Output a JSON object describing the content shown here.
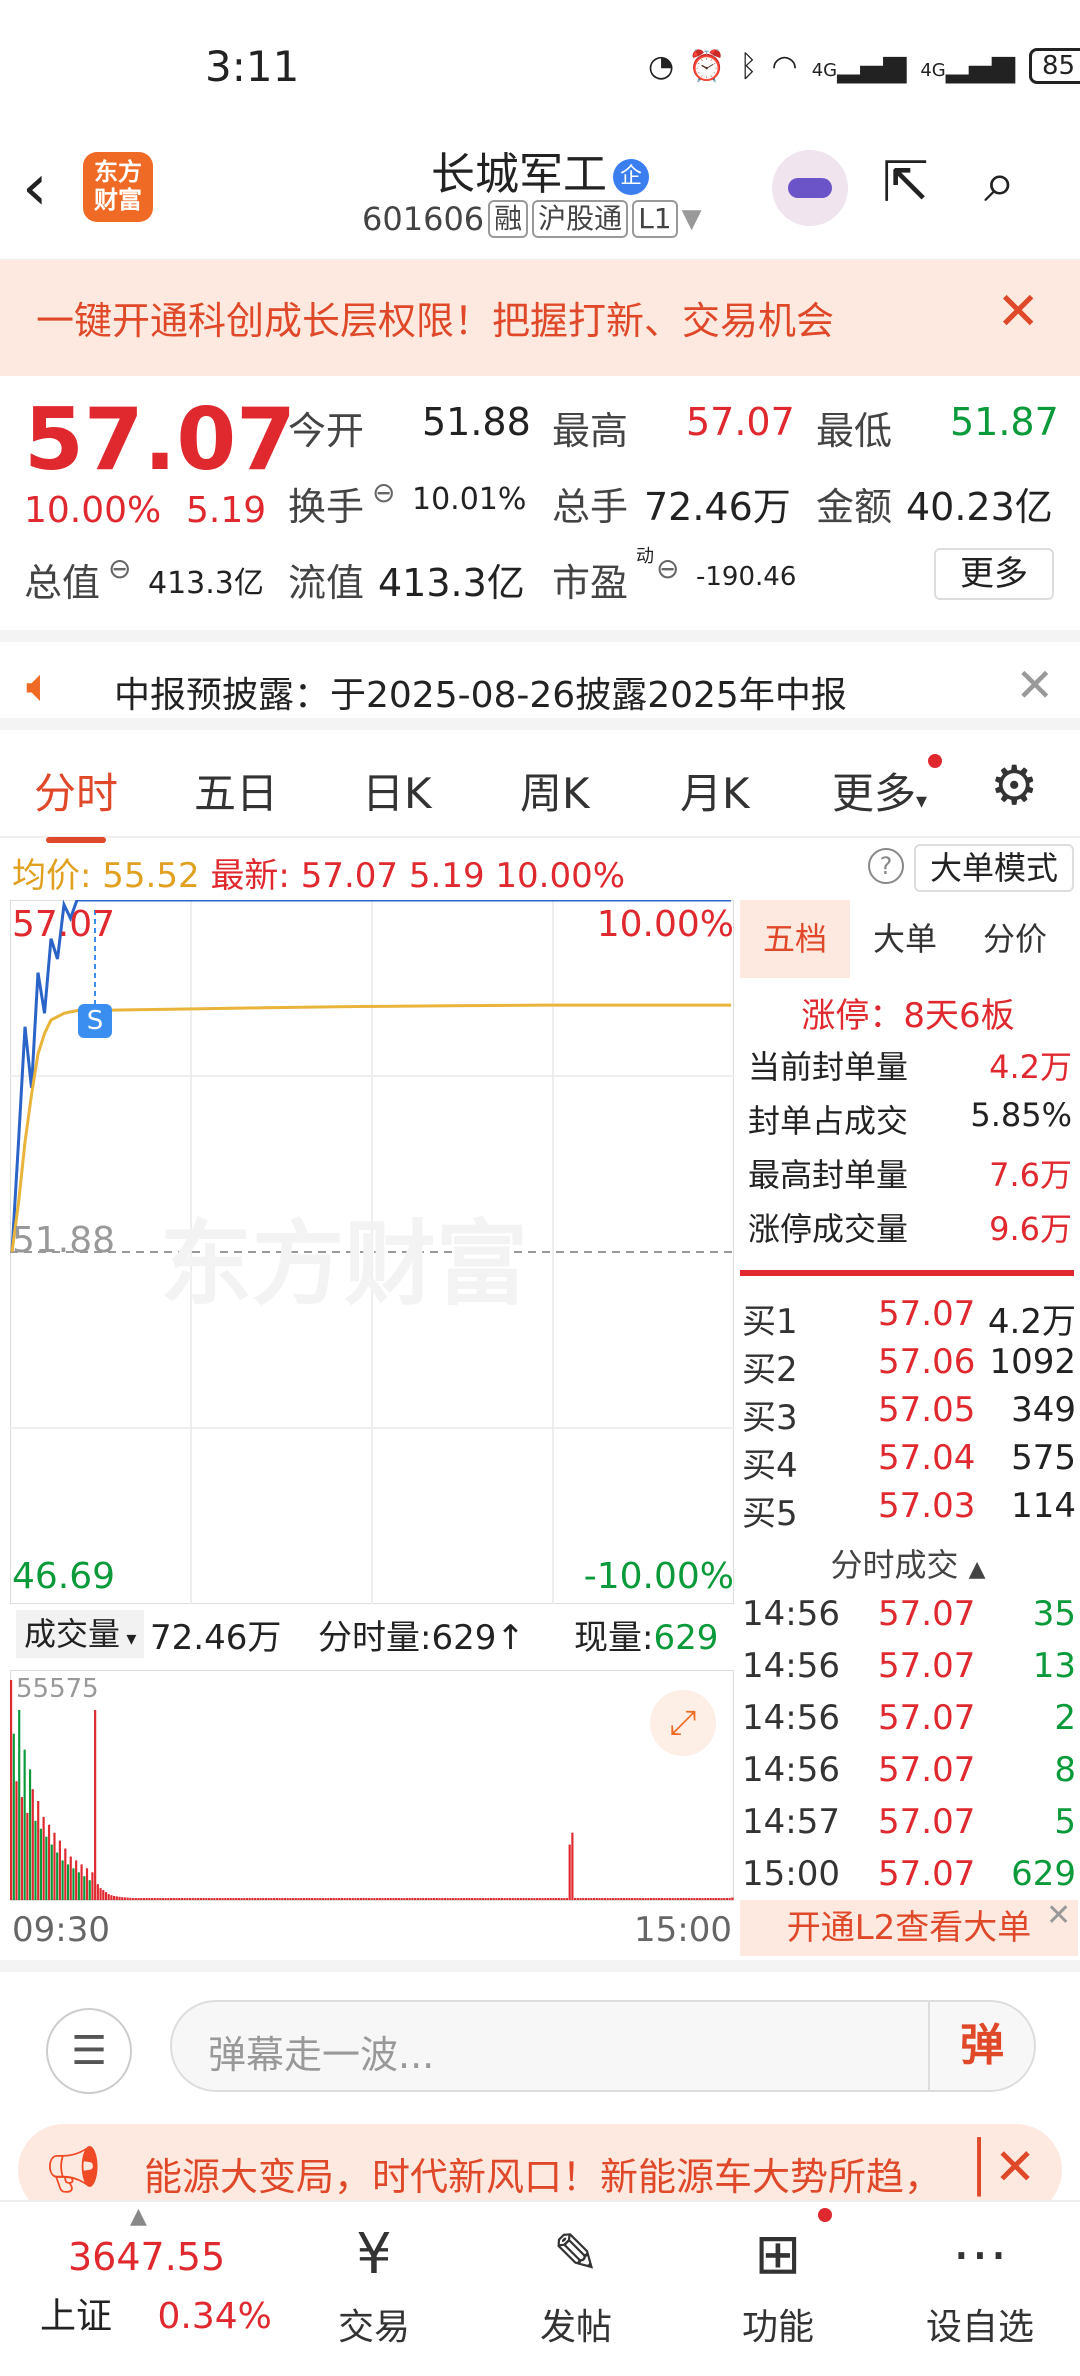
{
  "status_bar": {
    "time": "3:11",
    "signal1": "4G",
    "signal2": "4G",
    "battery": "85"
  },
  "header": {
    "logo_line1": "东方",
    "logo_line2": "财富",
    "stock_name": "长城军工",
    "badge": "企",
    "code": "601606",
    "tag1": "融",
    "tag2": "沪股通",
    "tag3": "L1"
  },
  "banner": {
    "text": "一键开通科创成长层权限！把握打新、交易机会"
  },
  "quote": {
    "price": "57.07",
    "change_pct": "10.00%",
    "change": "5.19",
    "open_label": "今开",
    "open": "51.88",
    "high_label": "最高",
    "high": "57.07",
    "low_label": "最低",
    "low": "51.87",
    "turnover_label": "换手",
    "turnover": "10.01%",
    "volume_label": "总手",
    "volume": "72.46万",
    "amount_label": "金额",
    "amount": "40.23亿",
    "mktcap_label": "总值",
    "mktcap": "413.3亿",
    "float_label": "流值",
    "float": "413.3亿",
    "pe_label": "市盈",
    "pe_sup": "动",
    "pe": "-190.46",
    "more_button": "更多"
  },
  "notice": {
    "text": "中报预披露：于2025-08-26披露2025年中报"
  },
  "tabs": [
    "分时",
    "五日",
    "日K",
    "周K",
    "月K",
    "更多"
  ],
  "info_bar": {
    "avg_label": "均价:",
    "avg": "55.52",
    "latest_label": "最新:",
    "latest": "57.07",
    "chg": "5.19",
    "pct": "10.00%",
    "mode_button": "大单模式"
  },
  "chart_data": {
    "type": "line",
    "series": [
      {
        "values": [
          51.88,
          53.5,
          55.2,
          54.3,
          56.0,
          55.4,
          56.5,
          56.2,
          57.0,
          56.8,
          57.07,
          57.07,
          57.07,
          57.07,
          57.07,
          57.07,
          57.07,
          57.07
        ]
      },
      {
        "values": [
          51.88,
          52.6,
          53.5,
          54.2,
          54.8,
          55.1,
          55.3,
          55.35,
          55.4,
          55.42,
          55.44,
          55.46,
          55.48,
          55.5,
          55.51,
          55.52,
          55.52,
          55.52
        ]
      }
    ],
    "x": [
      "09:30",
      "",
      "",
      "",
      "",
      "",
      "",
      "",
      "",
      "",
      "",
      "",
      "",
      "",
      "",
      "",
      "",
      "15:00"
    ],
    "ylim": [
      46.69,
      57.07
    ],
    "y_ticks_left": [
      "57.07",
      "51.88",
      "46.69"
    ],
    "y_ticks_right": [
      "10.00%",
      "-10.00%"
    ],
    "marker": "S",
    "watermark": "东方财富"
  },
  "volume": {
    "selector": "成交量",
    "total": "72.46万",
    "minute_label": "分时量:",
    "minute": "629",
    "current_label": "现量:",
    "current": "629",
    "max_tick": "55575",
    "x_start": "09:30",
    "x_end": "15:00",
    "bars": [
      55575,
      42000,
      30000,
      48000,
      26000,
      38000,
      22000,
      33000,
      28000,
      20000,
      25000,
      18000,
      21000,
      16000,
      19000,
      14000,
      17000,
      12000,
      15000,
      10000,
      13000,
      9000,
      11000,
      8000,
      10000,
      7000,
      9000,
      6000,
      8000,
      5000,
      7000,
      48000,
      4000,
      3000,
      2500,
      2000,
      1500,
      1200,
      1000,
      900,
      800,
      700,
      650,
      600,
      550,
      500,
      480,
      460,
      440,
      420,
      400,
      380,
      360,
      340,
      320,
      300,
      300,
      300,
      300,
      300,
      300,
      300,
      300,
      300,
      300,
      300,
      300,
      300,
      300,
      300,
      300,
      300,
      300,
      300,
      300,
      300,
      300,
      300,
      300,
      300,
      300,
      300,
      300,
      300,
      300,
      300,
      300,
      300,
      300,
      300,
      300,
      300,
      300,
      300,
      300,
      300,
      300,
      300,
      300,
      300,
      300,
      300,
      300,
      300,
      300,
      300,
      300,
      300,
      300,
      300,
      300,
      300,
      300,
      300,
      300,
      300,
      300,
      300,
      300,
      300,
      300,
      300,
      300,
      300,
      300,
      300,
      300,
      300,
      300,
      300,
      300,
      300,
      300,
      300,
      300,
      300,
      300,
      300,
      300,
      300,
      300,
      300,
      300,
      300,
      300,
      300,
      300,
      300,
      300,
      300,
      300,
      300,
      300,
      300,
      300,
      300,
      300,
      300,
      300,
      300,
      300,
      300,
      300,
      300,
      300,
      300,
      300,
      300,
      300,
      300,
      300,
      300,
      300,
      300,
      300,
      300,
      300,
      300,
      300,
      300,
      300,
      300,
      300,
      300,
      300,
      300,
      300,
      300,
      300,
      300,
      300,
      300,
      300,
      300,
      300,
      300,
      300,
      300,
      300,
      300,
      300,
      300,
      300,
      300,
      300,
      300,
      14000,
      17000,
      300,
      300,
      300,
      300,
      300,
      300,
      300,
      300,
      300,
      300,
      300,
      300,
      300,
      300,
      300,
      300,
      300,
      300,
      300,
      300,
      300,
      300,
      300,
      300,
      300,
      300,
      300,
      300,
      300,
      300,
      300,
      300,
      300,
      300,
      300,
      300,
      300,
      300,
      300,
      300,
      300,
      300,
      300,
      300,
      300,
      300,
      300,
      300,
      300,
      300,
      300,
      300,
      300,
      300,
      300,
      300,
      300,
      300,
      629
    ]
  },
  "right_panel": {
    "tabs": [
      "五档",
      "大单",
      "分价"
    ],
    "limit_up": "涨停：8天6板",
    "stats": [
      {
        "label": "当前封单量",
        "value": "4.2万"
      },
      {
        "label": "封单占成交",
        "value": "5.85%"
      },
      {
        "label": "最高封单量",
        "value": "7.6万"
      },
      {
        "label": "涨停成交量",
        "value": "9.6万"
      }
    ],
    "bids": [
      {
        "label": "买1",
        "price": "57.07",
        "vol": "4.2万"
      },
      {
        "label": "买2",
        "price": "57.06",
        "vol": "1092"
      },
      {
        "label": "买3",
        "price": "57.05",
        "vol": "349"
      },
      {
        "label": "买4",
        "price": "57.04",
        "vol": "575"
      },
      {
        "label": "买5",
        "price": "57.03",
        "vol": "114"
      }
    ],
    "ticks_title": "分时成交",
    "ticks": [
      {
        "time": "14:56",
        "price": "57.07",
        "vol": "35"
      },
      {
        "time": "14:56",
        "price": "57.07",
        "vol": "13"
      },
      {
        "time": "14:56",
        "price": "57.07",
        "vol": "2"
      },
      {
        "time": "14:56",
        "price": "57.07",
        "vol": "8"
      },
      {
        "time": "14:57",
        "price": "57.07",
        "vol": "5"
      },
      {
        "time": "15:00",
        "price": "57.07",
        "vol": "629"
      }
    ],
    "l2_button": "开通L2查看大单"
  },
  "danmu": {
    "placeholder": "弹幕走一波...",
    "send": "弹"
  },
  "ad": {
    "text": "能源大变局，时代新风口！新能源车大势所趋，"
  },
  "nav": {
    "index_value": "3647.55",
    "index_name": "上证",
    "index_pct": "0.34%",
    "items": [
      "交易",
      "发帖",
      "功能",
      "设自选"
    ]
  }
}
